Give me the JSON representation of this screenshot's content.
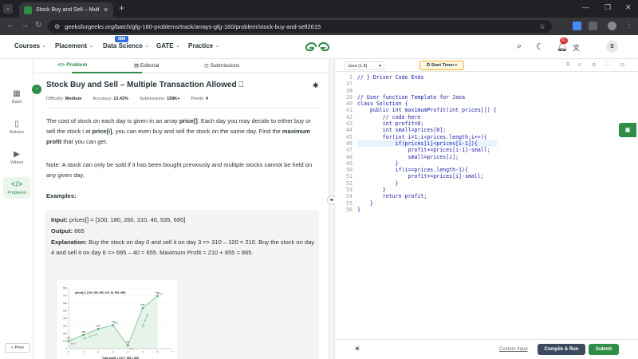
{
  "browser": {
    "tab_title": "Stock Buy and Sell – Multiple Tr",
    "url": "geeksforgeeks.org/batch/gfg-160-problems/track/arrays-gfg-160/problem/stock-buy-and-sell2615"
  },
  "site": {
    "nav": [
      "Courses",
      "Placement",
      "Data Science",
      "GATE",
      "Practice"
    ],
    "ibm_badge": "IBM",
    "notification_count": "51",
    "avatar_letter": "S",
    "logo_color": "#2f8d46"
  },
  "rail": {
    "items": [
      "Dash",
      "Articles",
      "Videos",
      "Problems"
    ],
    "prev_label": "« Prev"
  },
  "problem_tabs": [
    "Problem",
    "Editorial",
    "Submissions"
  ],
  "problem": {
    "title": "Stock Buy and Sell – Multiple Transaction Allowed",
    "difficulty_label": "Difficulty:",
    "difficulty": "Medium",
    "accuracy_label": "Accuracy:",
    "accuracy": "13.43%",
    "submissions_label": "Submissions:",
    "submissions": "158K+",
    "points_label": "Points:",
    "points": "4",
    "desc_1a": "The cost of stock on each day is given in an array ",
    "desc_1b": "price[]",
    "desc_1c": ". Each day you may decide to either buy or sell the stock i at ",
    "desc_1d": "price[i]",
    "desc_1e": ", you can even buy and sell the stock on the same day. Find the ",
    "desc_1f": "maximum profit",
    "desc_1g": " that you can get.",
    "desc_2": "Note: A stock can only be sold if it has been bought previously and multiple stocks cannot be held on any given day.",
    "examples_heading": "Examples:",
    "ex_input_label": "Input:",
    "ex_input": "prices[] = [100, 180, 260, 310, 40, 535, 695]",
    "ex_output_label": "Output:",
    "ex_output": "865",
    "ex_expl_label": "Explanation:",
    "ex_expl": "Buy the stock on day 0 and sell it on day 3 => 310 – 100 = 210. Buy the stock on day 4 and sell it on day 6 => 695 – 40 = 655. Maximum Profit = 210 + 655 = 865."
  },
  "editor": {
    "language": "Java (1.8)",
    "timer_label": "Start Timer",
    "line_numbers": [
      "1",
      "37",
      "38",
      "39",
      "40",
      "41",
      "42",
      "43",
      "44",
      "45",
      "46",
      "47",
      "48",
      "49",
      "50",
      "51",
      "52",
      "53",
      "54",
      "55",
      "56"
    ],
    "lines": [
      "// } Driver Code Ends",
      "",
      "",
      "// User function Template for Java",
      "class Solution {",
      "    public int maximumProfit(int prices[]) {",
      "        // code here",
      "        int profit=0;",
      "        int small=prices[0];",
      "        for(int i=1;i<prices.length;i++){",
      "            if(prices[i]<prices[i-1]){",
      "                profit+=prices[i-1]-small;",
      "                small=prices[i];",
      "            }",
      "            if(i==prices.length-1){",
      "                profit+=prices[i]-small;",
      "            }",
      "        }",
      "        return profit;",
      "    }",
      "}"
    ],
    "custom_input": "Custom Input",
    "compile_run": "Compile & Run",
    "submit": "Submit"
  },
  "chart_data": {
    "type": "line",
    "title": "prices[] = [100, 180, 260, 310, 40, 535, 695]",
    "x": [
      0,
      1,
      2,
      3,
      4,
      5,
      6
    ],
    "values": [
      100,
      180,
      260,
      310,
      40,
      535,
      695
    ],
    "value_labels": [
      "100",
      "180",
      "260",
      "310",
      "40",
      "535",
      "695"
    ],
    "xlim": [
      0,
      7
    ],
    "ylim": [
      0,
      800
    ],
    "x_ticks": [
      "0",
      "1",
      "2",
      "3",
      "4",
      "5",
      "6",
      "7"
    ],
    "y_ticks": [
      "0",
      "100",
      "200",
      "300",
      "400",
      "500",
      "600",
      "700",
      "800"
    ],
    "annotations": [
      "Buy",
      "Sell",
      "Buy",
      "Sell",
      "310 - 100 = 210",
      "695 - 40 = 655"
    ],
    "footer": "Total profit = 210 + 655 = 865",
    "line_color": "#8bc9a0"
  }
}
